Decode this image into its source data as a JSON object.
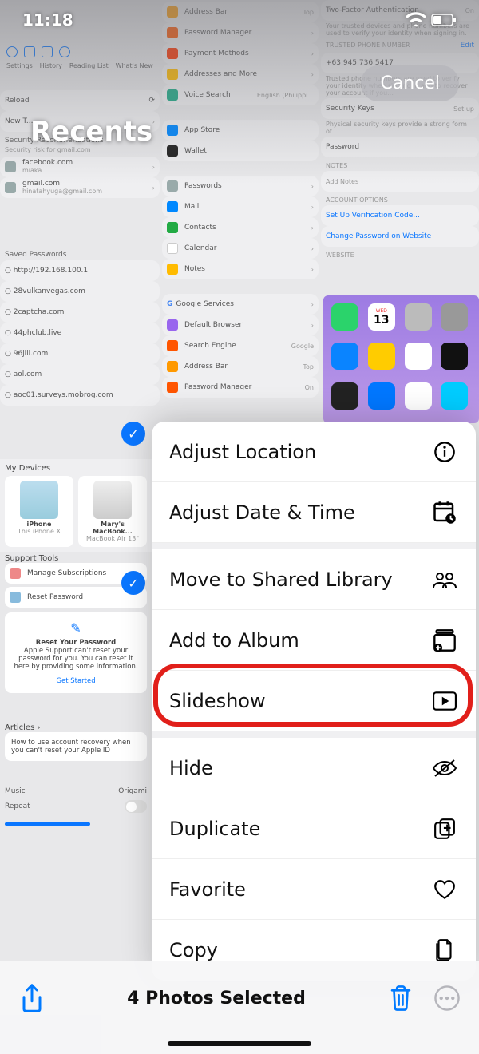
{
  "status_bar": {
    "time": "11:18"
  },
  "header": {
    "title": "Recents",
    "cancel": "Cancel"
  },
  "bg_col1": {
    "reload": "Reload",
    "newtab": "New T...",
    "sec_rec": "Security Recommendations",
    "sec_sub": "Security risk for gmail.com",
    "acc1": "facebook.com",
    "acc1_sub": "miaka",
    "acc2": "gmail.com",
    "acc2_sub": "hinatahyuga@gmail.com",
    "saved_h": "Saved Passwords",
    "pw1": "http://192.168.100.1",
    "pw2": "28vulkanvegas.com",
    "pw3": "2captcha.com",
    "pw4": "44phclub.live",
    "pw5": "96jili.com",
    "pw6": "aol.com",
    "pw7": "aoc01.surveys.mobrog.com",
    "devices_h": "My Devices",
    "dev1": "iPhone",
    "dev1_sub": "This iPhone X",
    "dev2": "Mary's MacBook...",
    "dev2_sub": "MacBook Air 13\"",
    "support_h": "Support Tools",
    "sup1": "Manage Subscriptions",
    "sup2": "Reset Password",
    "reset_card_h": "Reset Your Password",
    "reset_card_b": "Apple Support can't reset your password for you. You can reset it here by providing some information.",
    "reset_card_cta": "Get Started",
    "articles_h": "Articles",
    "art1": "How to use account recovery when you can't reset your Apple ID",
    "music_h": "Music",
    "origami": "Origami",
    "repeat": "Repeat"
  },
  "bg_col2": {
    "r1": "Address Bar",
    "r1_r": "Top",
    "r2": "Password Manager",
    "r3": "Payment Methods",
    "r4": "Addresses and More",
    "r5": "Voice Search",
    "r5_r": "English (Philippi...",
    "r6": "App Store",
    "r7": "Wallet",
    "r8": "Passwords",
    "r9": "Mail",
    "r10": "Contacts",
    "r11": "Calendar",
    "r12": "Notes",
    "r13": "Google Services",
    "r14": "Default Browser",
    "r15": "Search Engine",
    "r15_r": "Google",
    "r16": "Address Bar",
    "r16_r": "Top",
    "r17": "Password Manager",
    "r17_r": "On"
  },
  "bg_col3": {
    "twofa": "Two-Factor Authentication",
    "twofa_r": "On",
    "twofa_sub": "Your trusted devices and phone numbers are used to verify your identity when signing in.",
    "trusted_h": "TRUSTED PHONE NUMBER",
    "edit": "Edit",
    "phone": "+63 945 736 5417",
    "phone_sub": "Trusted phone numbers are used to verify your identity when signing in and to recover your account if you...",
    "seckeys": "Security Keys",
    "seckeys_r": "Set up",
    "seckeys_sub": "Physical security keys provide a strong form of...",
    "password": "Password",
    "notes_h": "NOTES",
    "addnotes": "Add Notes",
    "accopt_h": "ACCOUNT OPTIONS",
    "verif": "Set Up Verification Code...",
    "change": "Change Password on Website",
    "website_h": "WEBSITE"
  },
  "action_sheet": {
    "adjust_location": "Adjust Location",
    "adjust_date": "Adjust Date & Time",
    "move_shared": "Move to Shared Library",
    "add_album": "Add to Album",
    "slideshow": "Slideshow",
    "hide": "Hide",
    "duplicate": "Duplicate",
    "favorite": "Favorite",
    "copy": "Copy"
  },
  "bottom": {
    "selected": "4 Photos Selected"
  }
}
